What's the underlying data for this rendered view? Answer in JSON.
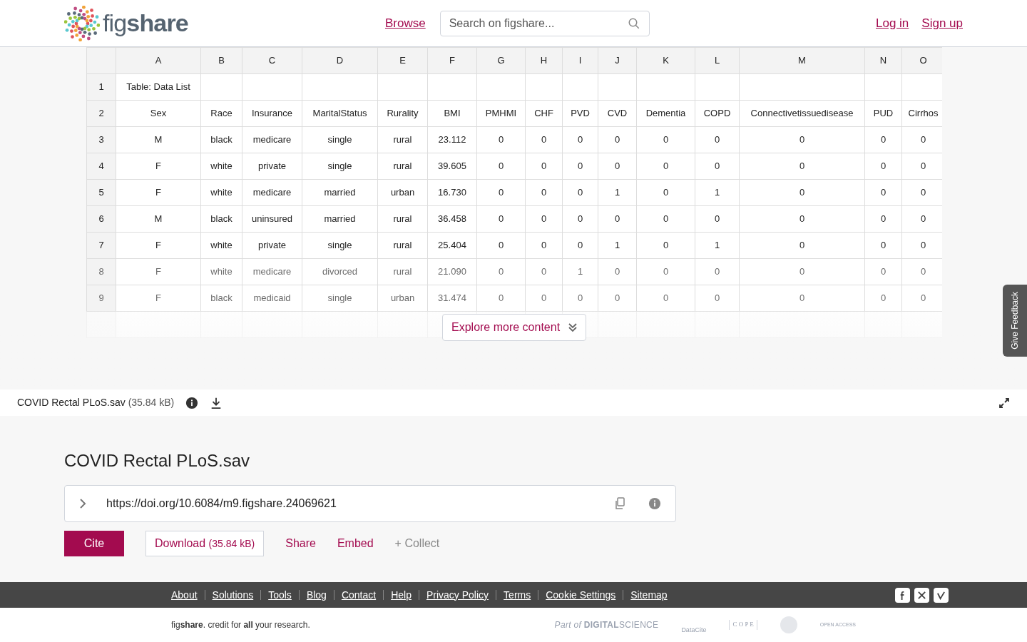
{
  "header": {
    "logo": "fig**share**",
    "browse": "Browse",
    "search_placeholder": "Search on figshare...",
    "auth_links": [
      "Log in",
      "Sign up"
    ]
  },
  "table": {
    "columns": [
      "A",
      "B",
      "C",
      "D",
      "E",
      "F",
      "G",
      "H",
      "I",
      "J",
      "K",
      "L",
      "M",
      "N",
      "O"
    ],
    "rows": [
      {
        "number": "1",
        "faded": false,
        "cells": [
          "Table: Data List"
        ]
      },
      {
        "number": "2",
        "faded": false,
        "cells": [
          "Sex",
          "Race",
          "Insurance",
          "MaritalStatus",
          "Rurality",
          "BMI",
          "PMHMI",
          "CHF",
          "PVD",
          "CVD",
          "Dementia",
          "COPD",
          "Connectivetissuedisease",
          "PUD",
          "Cirrhos"
        ]
      },
      {
        "number": "3",
        "faded": false,
        "cells": [
          "M",
          "black",
          "medicare",
          "single",
          "rural",
          "23.112",
          "0",
          "0",
          "0",
          "0",
          "0",
          "0",
          "0",
          "0",
          "0"
        ]
      },
      {
        "number": "4",
        "faded": false,
        "cells": [
          "F",
          "white",
          "private",
          "single",
          "rural",
          "39.605",
          "0",
          "0",
          "0",
          "0",
          "0",
          "0",
          "0",
          "0",
          "0"
        ]
      },
      {
        "number": "5",
        "faded": false,
        "cells": [
          "F",
          "white",
          "medicare",
          "married",
          "urban",
          "16.730",
          "0",
          "0",
          "0",
          "1",
          "0",
          "1",
          "0",
          "0",
          "0"
        ]
      },
      {
        "number": "6",
        "faded": false,
        "cells": [
          "M",
          "black",
          "uninsured",
          "married",
          "rural",
          "36.458",
          "0",
          "0",
          "0",
          "0",
          "0",
          "0",
          "0",
          "0",
          "0"
        ]
      },
      {
        "number": "7",
        "faded": false,
        "cells": [
          "F",
          "white",
          "private",
          "single",
          "rural",
          "25.404",
          "0",
          "0",
          "0",
          "1",
          "0",
          "1",
          "0",
          "0",
          "0"
        ]
      },
      {
        "number": "8",
        "faded": true,
        "cells": [
          "F",
          "white",
          "medicare",
          "divorced",
          "rural",
          "21.090",
          "0",
          "0",
          "1",
          "0",
          "0",
          "0",
          "0",
          "0",
          "0"
        ]
      },
      {
        "number": "9",
        "faded": true,
        "cells": [
          "F",
          "black",
          "medicaid",
          "single",
          "urban",
          "31.474",
          "0",
          "0",
          "0",
          "0",
          "0",
          "0",
          "0",
          "0",
          "0"
        ]
      }
    ]
  },
  "explore_button": "Explore more content",
  "feedback_tab": "Give Feedback",
  "file_bar": {
    "name": "COVID Rectal PLoS.sav",
    "size": "(35.84 kB)"
  },
  "item": {
    "title": "COVID Rectal PLoS.sav",
    "doi": "https://doi.org/10.6084/m9.figshare.24069621",
    "cite": "Cite",
    "download": "Download",
    "download_size": "(35.84 kB)",
    "share": "Share",
    "embed": "Embed",
    "collect": "+ Collect"
  },
  "footer": {
    "links": [
      "About",
      "Solutions",
      "Tools",
      "Blog",
      "Contact",
      "Help",
      "Privacy Policy",
      "Terms",
      "Cookie Settings",
      "Sitemap"
    ],
    "tagline": "fig**share**. credit for **all** your research.",
    "partners": [
      {
        "kind": "digital_science",
        "text": "*Part of* **DIGITAL**SCIENCE"
      },
      {
        "kind": "datacite",
        "text": "DataCite"
      },
      {
        "kind": "cope",
        "text": "C O P E"
      },
      {
        "kind": "seal"
      },
      {
        "kind": "open_access",
        "text": "OPEN ACCESS"
      }
    ]
  }
}
